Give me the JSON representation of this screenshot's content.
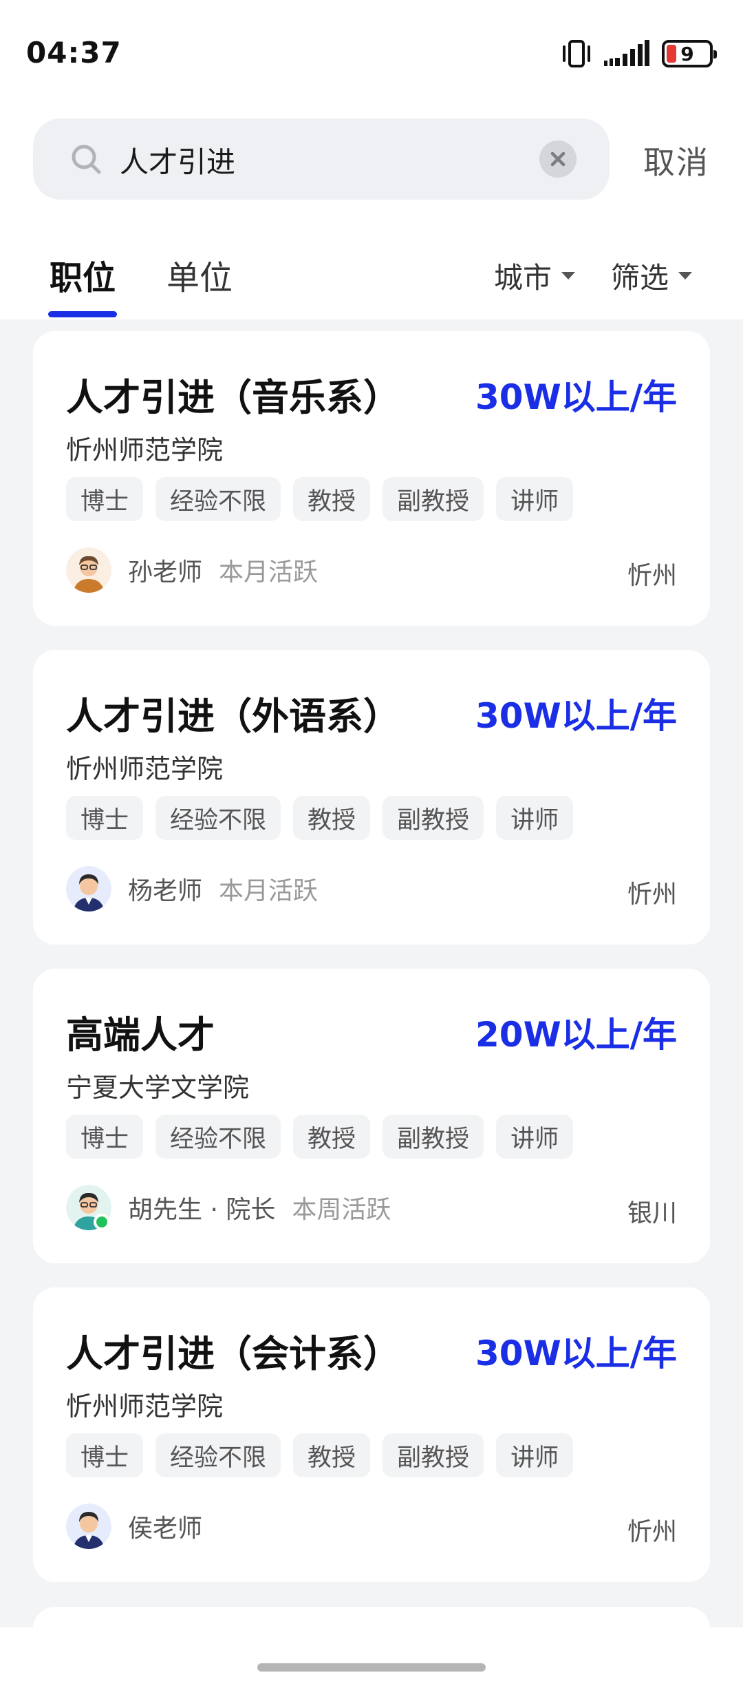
{
  "status_bar": {
    "time": "04:37",
    "battery": "9",
    "icons": [
      "vibrate-icon",
      "signal-icon",
      "battery-icon"
    ]
  },
  "search": {
    "query": "人才引进",
    "cancel_label": "取消"
  },
  "tabs": [
    {
      "label": "职位",
      "active": true
    },
    {
      "label": "单位",
      "active": false
    }
  ],
  "filters": {
    "city_label": "城市",
    "filter_label": "筛选"
  },
  "accent_color": "#1a2ee6",
  "jobs": [
    {
      "title": "人才引进（音乐系）",
      "salary": "30W以上/年",
      "company": "忻州师范学院",
      "tags": [
        "博士",
        "经验不限",
        "教授",
        "副教授",
        "讲师"
      ],
      "recruiter": "孙老师",
      "activity": "本月活跃",
      "city": "忻州",
      "avatar": "avatar-glasses-orange"
    },
    {
      "title": "人才引进（外语系）",
      "salary": "30W以上/年",
      "company": "忻州师范学院",
      "tags": [
        "博士",
        "经验不限",
        "教授",
        "副教授",
        "讲师"
      ],
      "recruiter": "杨老师",
      "activity": "本月活跃",
      "city": "忻州",
      "avatar": "avatar-suit-blue"
    },
    {
      "title": "高端人才",
      "salary": "20W以上/年",
      "company": "宁夏大学文学院",
      "tags": [
        "博士",
        "经验不限",
        "教授",
        "副教授",
        "讲师"
      ],
      "recruiter": "胡先生 · 院长",
      "activity": "本周活跃",
      "city": "银川",
      "avatar": "avatar-glasses-teal",
      "online": true
    },
    {
      "title": "人才引进（会计系）",
      "salary": "30W以上/年",
      "company": "忻州师范学院",
      "tags": [
        "博士",
        "经验不限",
        "教授",
        "副教授",
        "讲师"
      ],
      "recruiter": "侯老师",
      "activity": "",
      "city": "忻州",
      "avatar": "avatar-suit-blue"
    }
  ]
}
